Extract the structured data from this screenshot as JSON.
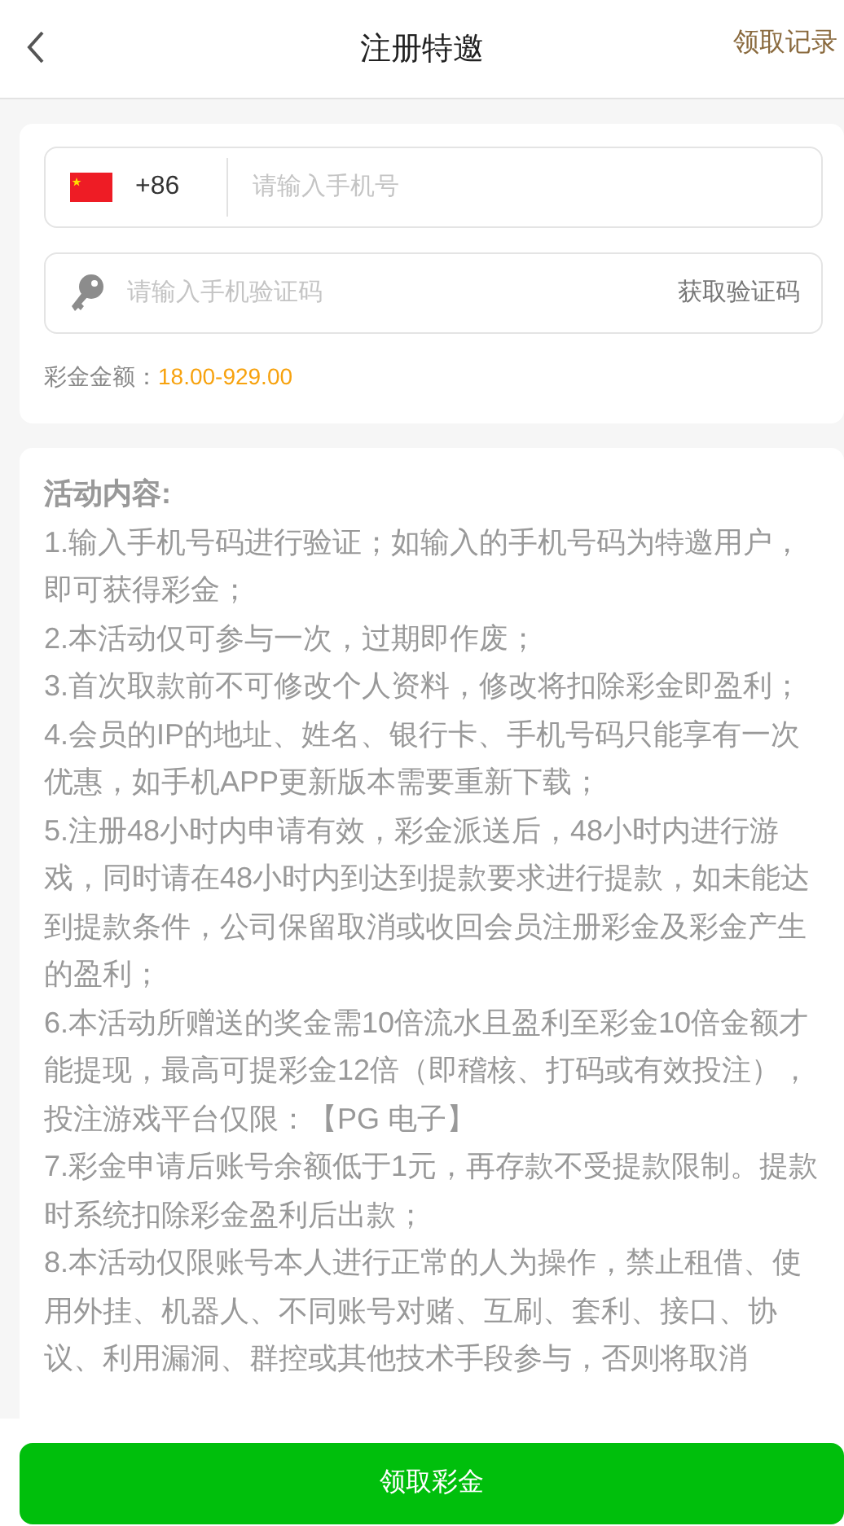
{
  "header": {
    "title": "注册特邀",
    "action": "领取记录"
  },
  "form": {
    "country_code": "+86",
    "phone_placeholder": "请输入手机号",
    "code_placeholder": "请输入手机验证码",
    "code_button": "获取验证码",
    "amount_label": "彩金金额：",
    "amount_value": "18.00-929.00"
  },
  "rules": {
    "heading": "活动内容:",
    "items": [
      "1.输入手机号码进行验证；如输入的手机号码为特邀用户，即可获得彩金；",
      "2.本活动仅可参与一次，过期即作废；",
      "3.首次取款前不可修改个人资料，修改将扣除彩金即盈利；",
      "4.会员的IP的地址、姓名、银行卡、手机号码只能享有一次优惠，如手机APP更新版本需要重新下载；",
      "5.注册48小时内申请有效，彩金派送后，48小时内进行游戏，同时请在48小时内到达到提款要求进行提款，如未能达到提款条件，公司保留取消或收回会员注册彩金及彩金产生的盈利；",
      "6.本活动所赠送的奖金需10倍流水且盈利至彩金10倍金额才能提现，最高可提彩金12倍（即稽核、打码或有效投注），投注游戏平台仅限：【PG 电子】",
      "7.彩金申请后账号余额低于1元，再存款不受提款限制。提款时系统扣除彩金盈利后出款；",
      "8.本活动仅限账号本人进行正常的人为操作，禁止租借、使用外挂、机器人、不同账号对赌、互刷、套利、接口、协议、利用漏洞、群控或其他技术手段参与，否则将取消"
    ]
  },
  "submit": "领取彩金"
}
